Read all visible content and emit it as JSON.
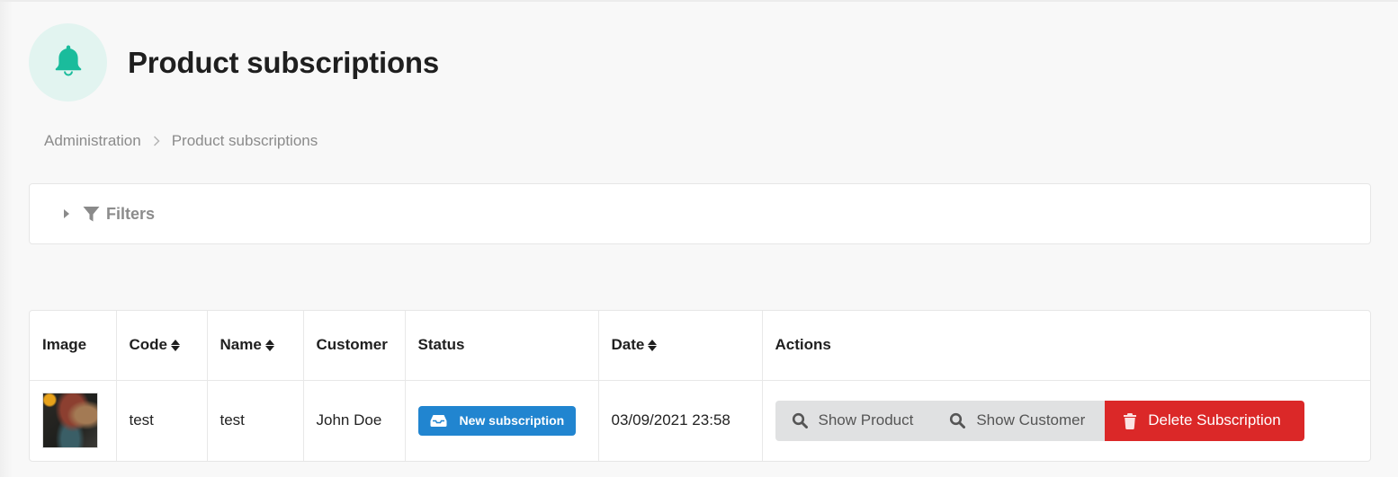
{
  "header": {
    "title": "Product subscriptions",
    "icon": "bell-icon",
    "icon_color": "#1abc9c",
    "icon_bg": "#e2f4f0"
  },
  "breadcrumb": {
    "items": [
      "Administration",
      "Product subscriptions"
    ]
  },
  "filters": {
    "label": "Filters"
  },
  "table": {
    "columns": [
      {
        "label": "Image",
        "sortable": false
      },
      {
        "label": "Code",
        "sortable": true
      },
      {
        "label": "Name",
        "sortable": true
      },
      {
        "label": "Customer",
        "sortable": false
      },
      {
        "label": "Status",
        "sortable": false
      },
      {
        "label": "Date",
        "sortable": true
      },
      {
        "label": "Actions",
        "sortable": false
      }
    ],
    "rows": [
      {
        "image": "product-thumbnail",
        "code": "test",
        "name": "test",
        "customer": "John Doe",
        "status": "New subscription",
        "date": "03/09/2021 23:58",
        "actions": {
          "show_product": "Show Product",
          "show_customer": "Show Customer",
          "delete": "Delete Subscription"
        }
      }
    ]
  },
  "colors": {
    "status_badge": "#2185d0",
    "delete_button": "#db2828",
    "secondary_button": "#e0e1e2"
  }
}
